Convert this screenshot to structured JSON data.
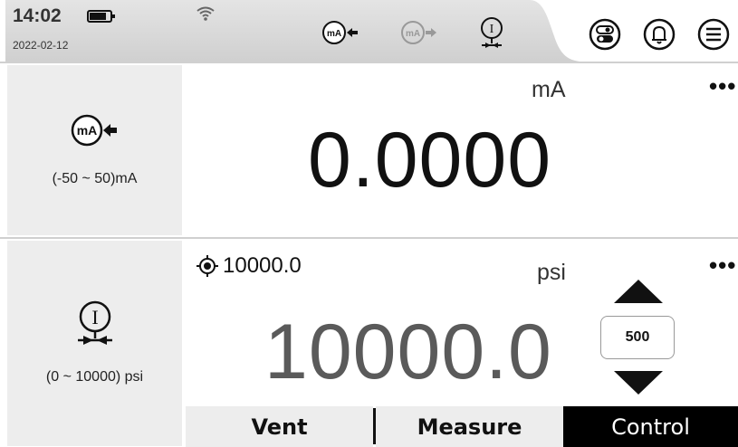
{
  "status_bar": {
    "time": "14:02",
    "date": "2022-02-12",
    "icons": [
      "battery-icon",
      "wifi-icon",
      "ma-source-icon",
      "ma-measure-icon",
      "pressure-controller-icon",
      "toggle-icon",
      "bell-icon",
      "menu-icon"
    ]
  },
  "channel1": {
    "range": "(-50 ~ 50)mA",
    "unit": "mA",
    "value": "0.0000",
    "more": "•••"
  },
  "channel2": {
    "range": "(0 ~ 10000) psi",
    "unit": "psi",
    "target": "10000.0",
    "value": "10000.0",
    "step": "500",
    "more": "•••"
  },
  "tabs": {
    "vent": "Vent",
    "measure": "Measure",
    "control": "Control"
  },
  "colors": {
    "panel": "#ededed",
    "active_tab": "#000000",
    "control_value": "#5a5a5a"
  }
}
